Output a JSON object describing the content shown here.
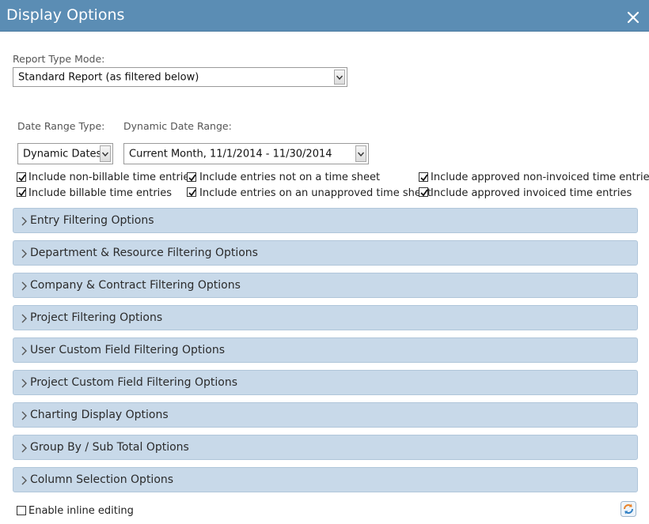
{
  "dialog": {
    "title": "Display Options"
  },
  "report_type": {
    "label": "Report Type Mode:",
    "value": "Standard Report (as filtered below)"
  },
  "date_range_type": {
    "label": "Date Range Type:",
    "value": "Dynamic Dates"
  },
  "dynamic_date_range": {
    "label": "Dynamic Date Range:",
    "value": "Current Month, 11/1/2014 - 11/30/2014"
  },
  "checkboxes": {
    "non_billable": {
      "label": "Include non-billable time entries",
      "checked": true
    },
    "billable": {
      "label": "Include billable time entries",
      "checked": true
    },
    "not_on_timesheet": {
      "label": "Include entries not on a time sheet",
      "checked": true
    },
    "unapproved_timesheet": {
      "label": "Include entries on an unapproved time sheet",
      "checked": true
    },
    "approved_non_invoiced": {
      "label": "Include approved non-invoiced time entries",
      "checked": true
    },
    "approved_invoiced": {
      "label": "Include approved invoiced time entries",
      "checked": true
    }
  },
  "sections": [
    {
      "label": "Entry Filtering Options"
    },
    {
      "label": "Department & Resource Filtering Options"
    },
    {
      "label": "Company & Contract Filtering Options"
    },
    {
      "label": "Project Filtering Options"
    },
    {
      "label": "User Custom Field Filtering Options"
    },
    {
      "label": "Project Custom Field Filtering Options"
    },
    {
      "label": "Charting Display Options"
    },
    {
      "label": "Group By / Sub Total Options"
    },
    {
      "label": "Column Selection Options"
    }
  ],
  "inline_editing": {
    "label": "Enable inline editing",
    "checked": false
  },
  "icons": {
    "close": "close-icon",
    "refresh": "refresh-icon",
    "chevron": "chevron-right-icon",
    "dropdown": "chevron-down-icon"
  },
  "colors": {
    "titlebar": "#5b8db4",
    "section_bg": "#c8d9e9",
    "refresh_orange": "#e8832a",
    "refresh_blue": "#2f7fc4"
  }
}
